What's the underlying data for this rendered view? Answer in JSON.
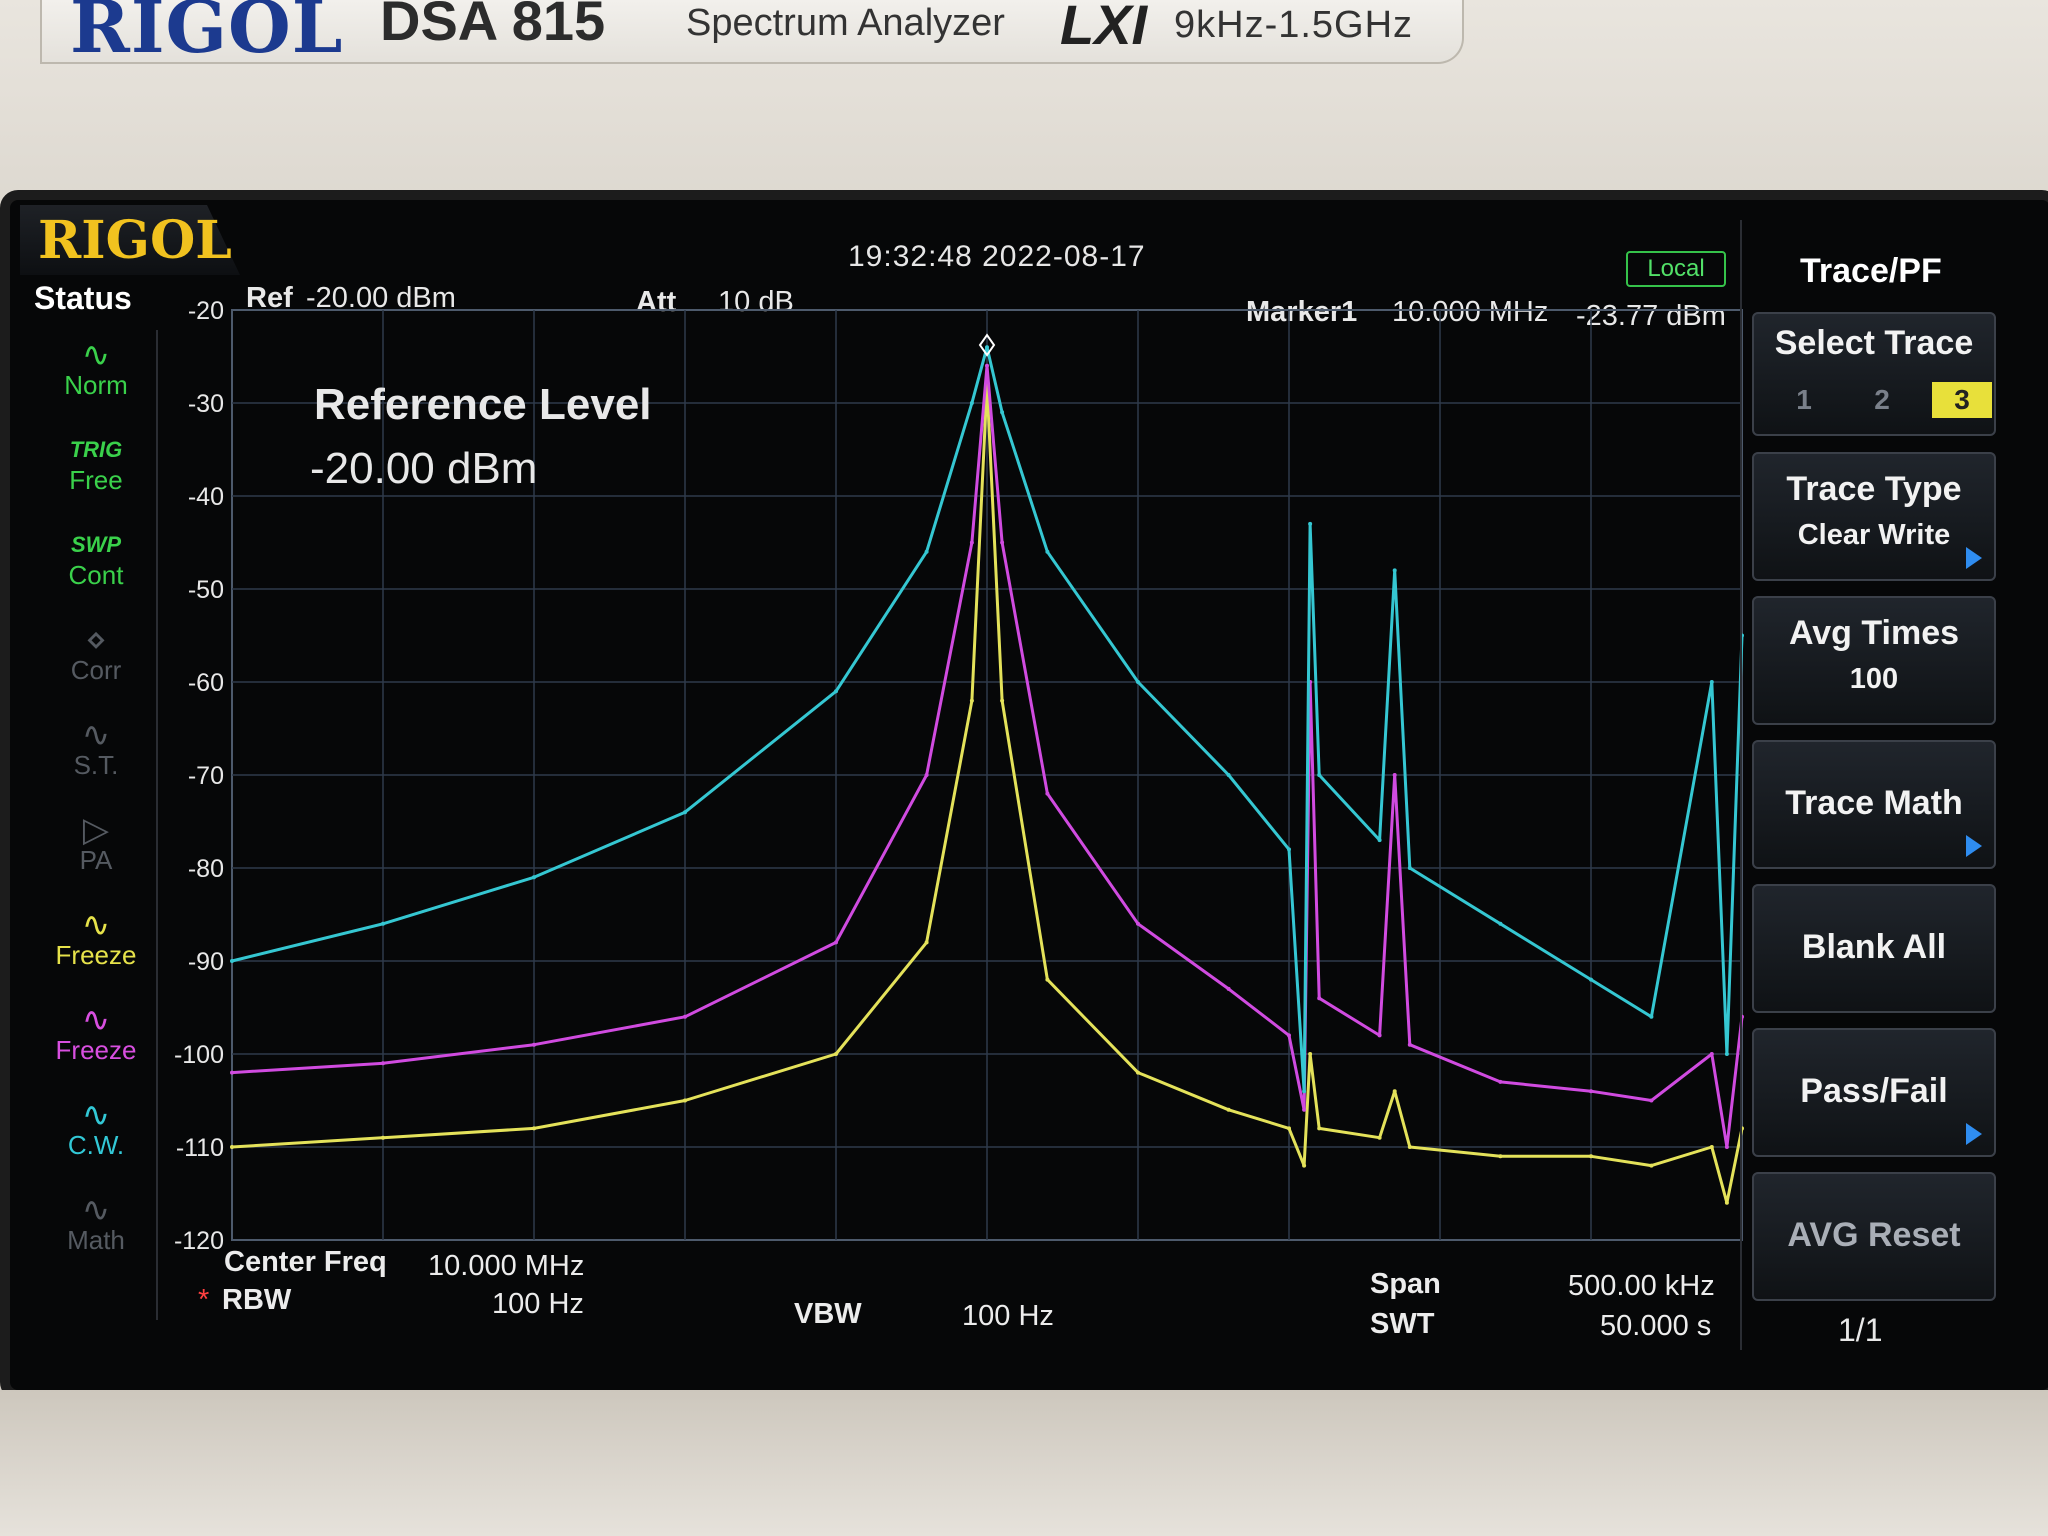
{
  "device": {
    "brand": "RIGOL",
    "model": "DSA 815",
    "type": "Spectrum Analyzer",
    "lxi": "LXI",
    "freq_range": "9kHz-1.5GHz"
  },
  "screen": {
    "logo": "RIGOL",
    "timestamp": "19:32:48 2022-08-17",
    "local_badge": "Local"
  },
  "status": {
    "title": "Status",
    "items": [
      {
        "top": "",
        "label": "Norm",
        "color": "#3ad14b"
      },
      {
        "top": "TRIG",
        "label": "Free",
        "color": "#3ad14b"
      },
      {
        "top": "SWP",
        "label": "Cont",
        "color": "#3ad14b"
      },
      {
        "top": "",
        "label": "Corr",
        "color": "#555a61"
      },
      {
        "top": "",
        "label": "S.T.",
        "color": "#555a61"
      },
      {
        "top": "",
        "label": "PA",
        "color": "#555a61"
      },
      {
        "top": "",
        "label": "Freeze",
        "color": "#e6e24a"
      },
      {
        "top": "",
        "label": "Freeze",
        "color": "#d84fe0"
      },
      {
        "top": "",
        "label": "C.W.",
        "color": "#32c8d6"
      },
      {
        "top": "",
        "label": "Math",
        "color": "#555a61"
      }
    ]
  },
  "header": {
    "ref_label": "Ref",
    "ref_value": "-20.00 dBm",
    "att_label": "Att",
    "att_value": "10 dB",
    "marker_label": "Marker1",
    "marker_freq": "10.000 MHz",
    "marker_amp": "-23.77 dBm"
  },
  "overlay": {
    "line1": "Reference Level",
    "line2": "-20.00 dBm"
  },
  "footer": {
    "center_freq_label": "Center Freq",
    "center_freq_value": "10.000 MHz",
    "rbw_mark": "*",
    "rbw_label": "RBW",
    "rbw_value": "100 Hz",
    "vbw_label": "VBW",
    "vbw_value": "100 Hz",
    "span_label": "Span",
    "span_value": "500.00 kHz",
    "swt_label": "SWT",
    "swt_value": "50.000 s"
  },
  "menu": {
    "title": "Trace/PF",
    "select_trace": "Select Trace",
    "trace_options": [
      "1",
      "2",
      "3"
    ],
    "selected_trace": "3",
    "trace_type": "Trace Type",
    "trace_type_value": "Clear Write",
    "avg_times": "Avg Times",
    "avg_times_value": "100",
    "trace_math": "Trace Math",
    "blank_all": "Blank All",
    "pass_fail": "Pass/Fail",
    "avg_reset": "AVG Reset",
    "page": "1/1"
  },
  "colors": {
    "grid": "#2f3a4a",
    "trace_cyan": "#35c7d2",
    "trace_magenta": "#d04be0",
    "trace_yellow": "#e4e25a",
    "selected_key": "#e8e03a"
  },
  "chart_data": {
    "type": "line",
    "y_tick_labels": [
      "-20",
      "-30",
      "-40",
      "-50",
      "-60",
      "-70",
      "-80",
      "-90",
      "-100",
      "-110",
      "-120"
    ],
    "ylim": [
      -120,
      -20
    ],
    "xlim": [
      9.75,
      10.25
    ],
    "x_unit": "MHz",
    "y_unit": "dBm",
    "grid": true,
    "marker": {
      "x": 10.0,
      "y": -23.77
    },
    "series": [
      {
        "name": "",
        "color": "#35c7d2",
        "x": [
          9.75,
          9.8,
          9.85,
          9.9,
          9.95,
          9.98,
          9.995,
          10.0,
          10.005,
          10.02,
          10.05,
          10.08,
          10.1,
          10.105,
          10.107,
          10.11,
          10.13,
          10.135,
          10.14,
          10.17,
          10.2,
          10.22,
          10.24,
          10.245,
          10.25
        ],
        "y": [
          -90,
          -86,
          -81,
          -74,
          -61,
          -46,
          -30,
          -24,
          -31,
          -46,
          -60,
          -70,
          -78,
          -104,
          -43,
          -70,
          -77,
          -48,
          -80,
          -86,
          -92,
          -96,
          -60,
          -100,
          -55
        ]
      },
      {
        "name": "",
        "color": "#d04be0",
        "x": [
          9.75,
          9.8,
          9.85,
          9.9,
          9.95,
          9.98,
          9.995,
          10.0,
          10.005,
          10.02,
          10.05,
          10.08,
          10.1,
          10.105,
          10.107,
          10.11,
          10.13,
          10.135,
          10.14,
          10.17,
          10.2,
          10.22,
          10.24,
          10.245,
          10.25
        ],
        "y": [
          -102,
          -101,
          -99,
          -96,
          -88,
          -70,
          -45,
          -26,
          -45,
          -72,
          -86,
          -93,
          -98,
          -106,
          -60,
          -94,
          -98,
          -70,
          -99,
          -103,
          -104,
          -105,
          -100,
          -110,
          -96
        ]
      },
      {
        "name": "",
        "color": "#e4e25a",
        "x": [
          9.75,
          9.8,
          9.85,
          9.9,
          9.95,
          9.98,
          9.995,
          10.0,
          10.005,
          10.02,
          10.05,
          10.08,
          10.1,
          10.105,
          10.107,
          10.11,
          10.13,
          10.135,
          10.14,
          10.17,
          10.2,
          10.22,
          10.24,
          10.245,
          10.25
        ],
        "y": [
          -110,
          -109,
          -108,
          -105,
          -100,
          -88,
          -62,
          -28,
          -62,
          -92,
          -102,
          -106,
          -108,
          -112,
          -100,
          -108,
          -109,
          -104,
          -110,
          -111,
          -111,
          -112,
          -110,
          -116,
          -108
        ]
      }
    ]
  }
}
